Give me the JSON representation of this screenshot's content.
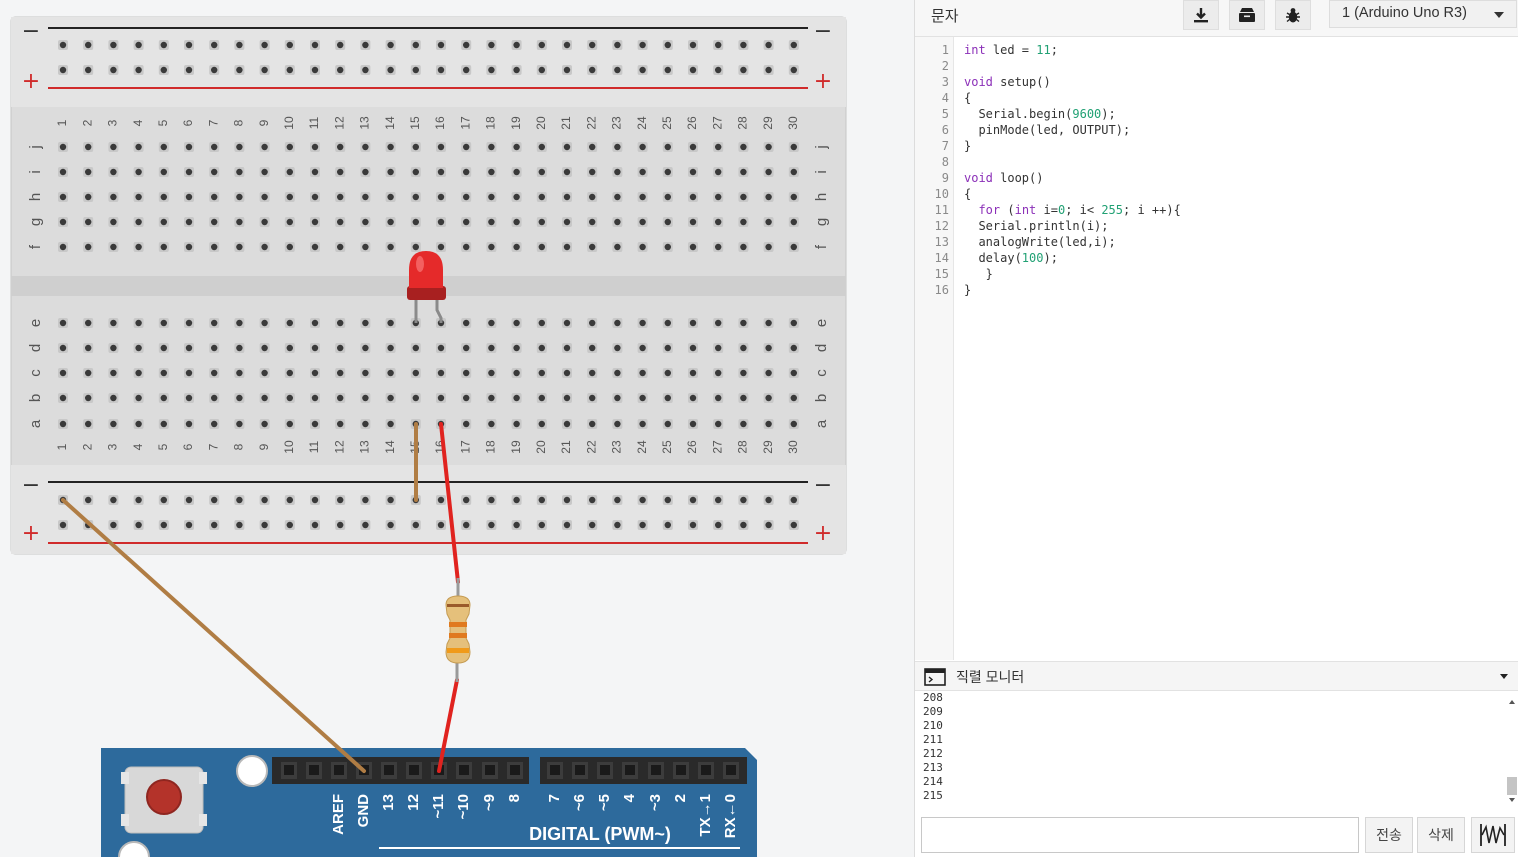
{
  "breadboard": {
    "rail_minus": "−",
    "rail_plus": "+",
    "columns": [
      "1",
      "2",
      "3",
      "4",
      "5",
      "6",
      "7",
      "8",
      "9",
      "10",
      "11",
      "12",
      "13",
      "14",
      "15",
      "16",
      "17",
      "18",
      "19",
      "20",
      "21",
      "22",
      "23",
      "24",
      "25",
      "26",
      "27",
      "28",
      "29",
      "30"
    ],
    "rows_top": [
      "j",
      "i",
      "h",
      "g",
      "f"
    ],
    "rows_bottom": [
      "e",
      "d",
      "c",
      "b",
      "a"
    ]
  },
  "arduino": {
    "pin_labels": [
      "AREF",
      "GND",
      "13",
      "12",
      "~11",
      "~10",
      "~9",
      "8",
      "7",
      "~6",
      "~5",
      "4",
      "~3",
      "2",
      "TX→1",
      "RX←0"
    ],
    "digital_label": "DIGITAL (PWM~)"
  },
  "colors": {
    "wire_red": "#e0231f",
    "wire_brown": "#b07d44",
    "led_red": "#e52a2a",
    "board_blue": "#2d6a9c",
    "rail_red": "#d02b2b"
  },
  "toolbar": {
    "mode_label": "문자",
    "download_icon": "download-icon",
    "library_icon": "library-icon",
    "debug_icon": "bug-icon",
    "board_select": "1 (Arduino Uno R3)"
  },
  "code": {
    "lines": [
      "int led = 11;",
      "",
      "void setup()",
      "{",
      "  Serial.begin(9600);",
      "  pinMode(led, OUTPUT);",
      "}",
      "",
      "void loop()",
      "{",
      "  for (int i=0; i< 255; i ++){",
      "  Serial.println(i);",
      "  analogWrite(led,i);",
      "  delay(100);",
      "   }",
      "}"
    ]
  },
  "serial": {
    "title": "직렬 모니터",
    "output": [
      "208",
      "209",
      "210",
      "211",
      "212",
      "213",
      "214",
      "215"
    ],
    "send_label": "전송",
    "clear_label": "삭제",
    "graph_icon": "graph-icon",
    "input_value": ""
  }
}
